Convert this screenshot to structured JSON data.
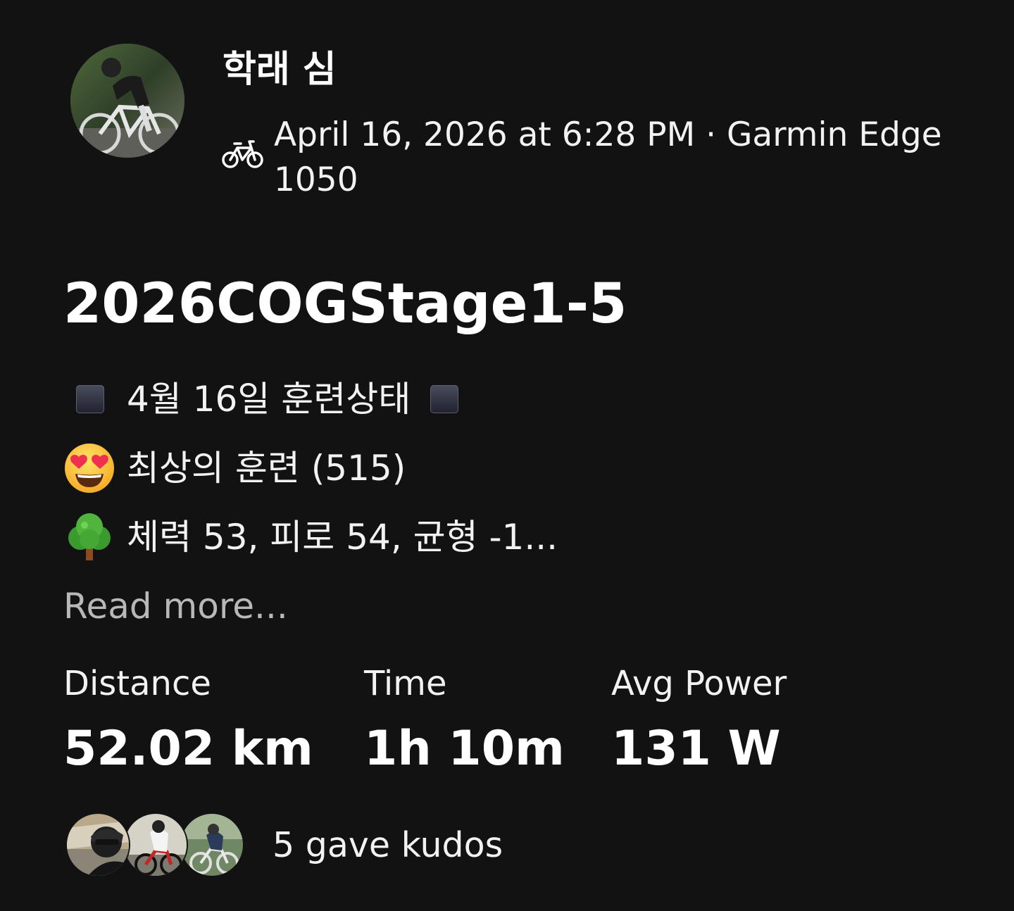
{
  "athlete": {
    "name": "학래 심",
    "avatar": "cyclist-photo"
  },
  "activity": {
    "sport_icon": "bike-icon",
    "meta": "April 16, 2026 at 6:28 PM · Garmin Edge 1050",
    "title": "2026COGStage1-5"
  },
  "description": {
    "line1": "4월 16일 훈련상태",
    "line1_icons": [
      "black-square-icon",
      "black-square-icon"
    ],
    "line2": "최상의 훈련 (515)",
    "line2_icon": "heart-eyes-emoji-icon",
    "line3": "체력 53, 피로 54, 균형 -1...",
    "line3_icon": "tree-emoji-icon"
  },
  "read_more_label": "Read more...",
  "stats": [
    {
      "label": "Distance",
      "value": "52.02 km"
    },
    {
      "label": "Time",
      "value": "1h 10m"
    },
    {
      "label": "Avg Power",
      "value": "131 W"
    }
  ],
  "kudos": {
    "avatars": [
      "kudos-avatar-1",
      "kudos-avatar-2",
      "kudos-avatar-3"
    ],
    "text": "5 gave kudos"
  }
}
